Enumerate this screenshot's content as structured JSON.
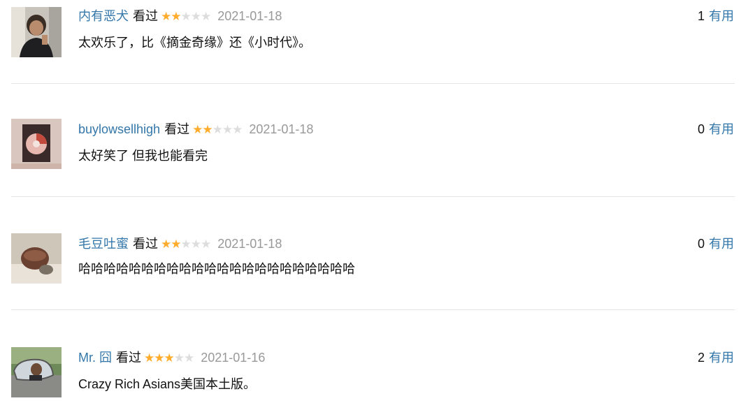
{
  "comments": [
    {
      "user": "内有恶犬",
      "status": "看过",
      "rating": 2,
      "date": "2021-01-18",
      "text": "太欢乐了，比《摘金奇缘》还《小时代》。",
      "votes": "1",
      "vote_label": "有用"
    },
    {
      "user": "buylowsellhigh",
      "status": "看过",
      "rating": 2,
      "date": "2021-01-18",
      "text": "太好笑了 但我也能看完",
      "votes": "0",
      "vote_label": "有用"
    },
    {
      "user": "毛豆吐蜜",
      "status": "看过",
      "rating": 2,
      "date": "2021-01-18",
      "text": "哈哈哈哈哈哈哈哈哈哈哈哈哈哈哈哈哈哈哈哈哈哈",
      "votes": "0",
      "vote_label": "有用"
    },
    {
      "user": "Mr. 囧",
      "status": "看过",
      "rating": 3,
      "date": "2021-01-16",
      "text": "Crazy Rich Asians美国本土版。",
      "votes": "2",
      "vote_label": "有用"
    }
  ],
  "colors": {
    "link": "#3377aa",
    "star_on": "#ffac2d",
    "star_off": "#dddddd",
    "date": "#999999"
  }
}
